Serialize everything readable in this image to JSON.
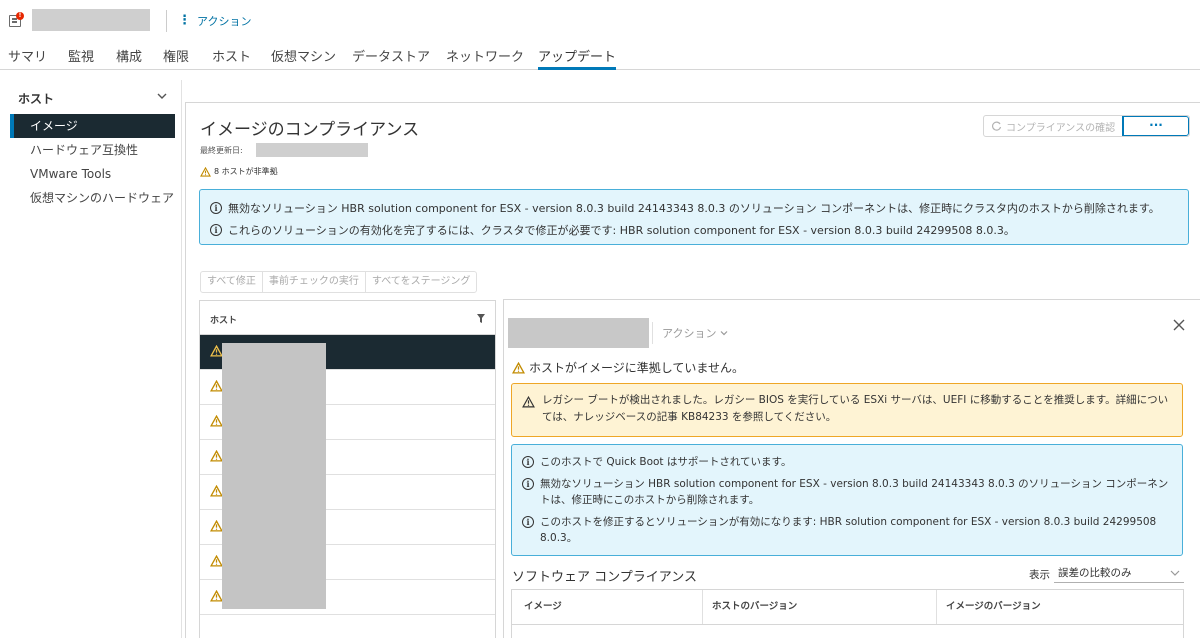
{
  "header": {
    "actions_label": "アクション"
  },
  "tabs": [
    {
      "label": "サマリ",
      "active": false
    },
    {
      "label": "監視",
      "active": false
    },
    {
      "label": "構成",
      "active": false
    },
    {
      "label": "権限",
      "active": false
    },
    {
      "label": "ホスト",
      "active": false
    },
    {
      "label": "仮想マシン",
      "active": false
    },
    {
      "label": "データストア",
      "active": false
    },
    {
      "label": "ネットワーク",
      "active": false
    },
    {
      "label": "アップデート",
      "active": true
    }
  ],
  "sidebar": {
    "section_title": "ホスト",
    "items": [
      {
        "label": "イメージ",
        "active": true
      },
      {
        "label": "ハードウェア互換性",
        "active": false
      },
      {
        "label": "VMware Tools",
        "active": false
      },
      {
        "label": "仮想マシンのハードウェア",
        "active": false
      }
    ]
  },
  "main": {
    "title": "イメージのコンプライアンス",
    "last_updated_label": "最終更新日:",
    "noncompliant_text": "8 ホストが非準拠",
    "check_compliance_label": "コンプライアンスの確認",
    "more_label": "···",
    "info_messages": [
      "無効なソリューション HBR solution component for ESX - version 8.0.3 build 24143343 8.0.3 のソリューション コンポーネントは、修正時にクラスタ内のホストから削除されます。",
      "これらのソリューションの有効化を完了するには、クラスタで修正が必要です: HBR solution component for ESX - version 8.0.3 build 24299508 8.0.3。"
    ],
    "action_buttons": [
      "すべて修正",
      "事前チェックの実行",
      "すべてをステージング"
    ]
  },
  "host_list": {
    "header": "ホスト",
    "row_count": 8
  },
  "details": {
    "actions_label": "アクション",
    "warning_title": "ホストがイメージに準拠していません。",
    "legacy_warning": "レガシー ブートが検出されました。レガシー BIOS を実行している ESXi サーバは、UEFI に移動することを推奨します。詳細については、ナレッジベースの記事 KB84233 を参照してください。",
    "info_messages": [
      "このホストで Quick Boot はサポートされています。",
      "無効なソリューション HBR solution component for ESX - version 8.0.3 build 24143343 8.0.3 のソリューション コンポーネントは、修正時にこのホストから削除されます。",
      "このホストを修正するとソリューションが有効になります: HBR solution component for ESX - version 8.0.3 build 24299508 8.0.3。"
    ],
    "software_compliance_title": "ソフトウェア コンプライアンス",
    "display_label": "表示",
    "display_value": "誤差の比較のみ",
    "table_headers": [
      "イメージ",
      "ホストのバージョン",
      "イメージのバージョン"
    ]
  },
  "colors": {
    "accent": "#0079b8",
    "selected_bg": "#1b2a32",
    "info_bg": "#e3f5fc",
    "warning_bg": "#fef3d4",
    "warning_icon": "#c28b00"
  }
}
